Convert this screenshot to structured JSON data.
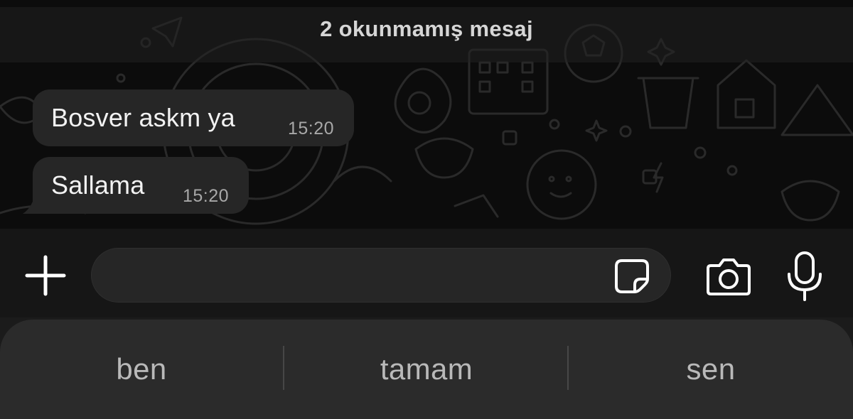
{
  "chat": {
    "unread_banner": "2 okunmamış mesaj",
    "messages": [
      {
        "text": "Bosver askm ya",
        "time": "15:20"
      },
      {
        "text": "Sallama",
        "time": "15:20"
      }
    ]
  },
  "composer": {
    "input_value": "",
    "plus_icon": "plus-icon",
    "sticker_icon": "sticker-icon",
    "camera_icon": "camera-icon",
    "mic_icon": "microphone-icon"
  },
  "keyboard": {
    "suggestions": [
      "ben",
      "tamam",
      "sen"
    ]
  },
  "colors": {
    "background": "#0c0c0c",
    "bubble": "#262626",
    "composer": "#161616",
    "suggestion_bar": "#2b2b2b",
    "icon": "#ffffff"
  }
}
